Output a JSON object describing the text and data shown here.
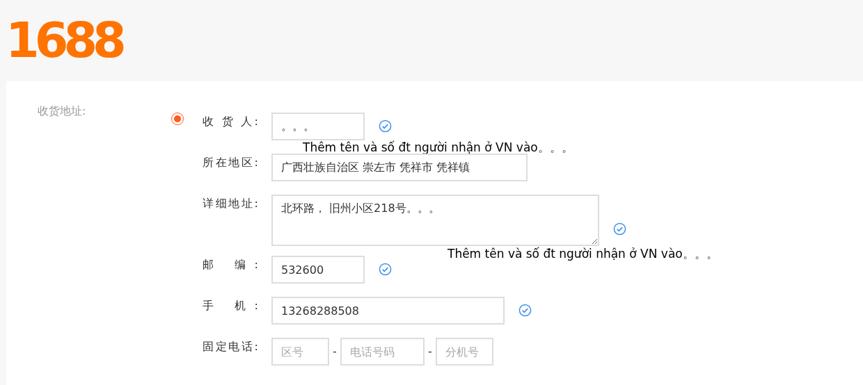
{
  "logo": {
    "text": "1688"
  },
  "section_label": "收货地址:",
  "address_option": {
    "selected": true
  },
  "fields": [
    {
      "kind": "name",
      "label": "收 货 人:",
      "value": "。。。",
      "valid": true,
      "note": "Thêm tên và số đt người nhận ở VN vào。。。"
    },
    {
      "kind": "region",
      "label": "所在地区:",
      "value": "广西壮族自治区 崇左市 凭祥市 凭祥镇",
      "valid": false
    },
    {
      "kind": "address",
      "label": "详细地址:",
      "value": "北环路， 旧州小区218号。。。",
      "valid": true,
      "note": "Thêm tên và số đt người nhận ở VN vào。。。"
    },
    {
      "kind": "postcode",
      "label": "邮 编:",
      "value": "532600",
      "valid": true
    },
    {
      "kind": "mobile",
      "label": "手 机:",
      "value": "13268288508",
      "valid": true
    },
    {
      "kind": "landline",
      "label": "固定电话:",
      "parts": [
        {
          "placeholder": "区号"
        },
        {
          "placeholder": "电话号码"
        },
        {
          "placeholder": "分机号"
        }
      ],
      "separators": [
        "-",
        "-"
      ]
    }
  ]
}
